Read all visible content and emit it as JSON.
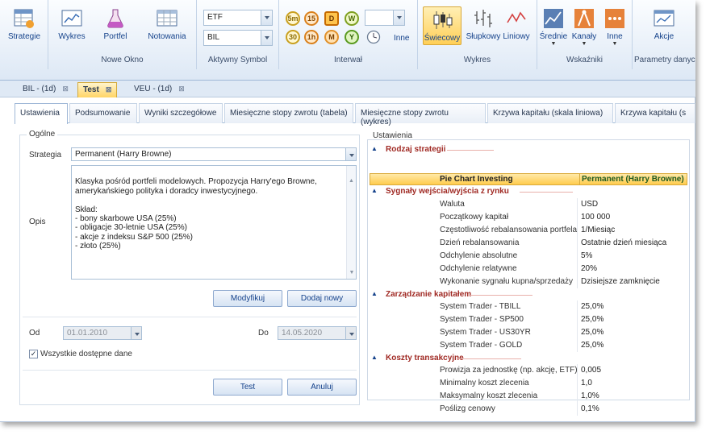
{
  "ribbon": {
    "strategie": "Strategie",
    "nowe_okno": {
      "label": "Nowe Okno",
      "items": [
        "Wykres",
        "Portfel",
        "Notowania"
      ]
    },
    "aktywny_symbol": {
      "label": "Aktywny Symbol",
      "symbol1": "ETF",
      "symbol2": "BIL"
    },
    "interwal": {
      "label": "Interwał",
      "row1": [
        "5m",
        "15",
        "D",
        "W"
      ],
      "row2": [
        "30",
        "1h",
        "M",
        "Y"
      ],
      "inne": "Inne"
    },
    "wykres": {
      "label": "Wykres",
      "items": [
        "Świecowy",
        "Słupkowy",
        "Liniowy"
      ]
    },
    "wskazniki": {
      "label": "Wskaźniki",
      "items": [
        "Średnie",
        "Kanały",
        "Inne"
      ]
    },
    "parametry": {
      "label": "Parametry danych",
      "akcje": "Akcje"
    }
  },
  "doc_tabs": [
    {
      "label": "BIL - (1d)",
      "active": false
    },
    {
      "label": "Test",
      "active": true
    },
    {
      "label": "VEU - (1d)",
      "active": false
    }
  ],
  "sub_tabs": [
    "Ustawienia",
    "Podsumowanie",
    "Wyniki szczegółowe",
    "Miesięczne stopy zwrotu (tabela)",
    "Miesięczne stopy zwrotu (wykres)",
    "Krzywa kapitału (skala liniowa)",
    "Krzywa kapitału (s"
  ],
  "ogolne": {
    "title": "Ogólne",
    "strategia_label": "Strategia",
    "strategia_value": "Permanent (Harry Browne)",
    "opis_label": "Opis",
    "opis_text": "Klasyka pośród portfeli modelowych. Propozycja Harry'ego Browne,\namerykańskiego polityka i doradcy inwestycyjnego.\n\nSkład:\n- bony skarbowe USA (25%)\n- obligacje 30-letnie USA (25%)\n- akcje z indeksu S&P 500 (25%)\n- złoto (25%)",
    "modyfikuj": "Modyfikuj",
    "dodaj_nowy": "Dodaj nowy",
    "od_label": "Od",
    "od_value": "01.01.2010",
    "do_label": "Do",
    "do_value": "14.05.2020",
    "wszystkie": "Wszystkie dostępne dane",
    "test": "Test",
    "anuluj": "Anuluj"
  },
  "ustawienia": {
    "title": "Ustawienia",
    "rodzaj": "Rodzaj strategii",
    "header_key": "Pie Chart Investing",
    "header_value": "Permanent (Harry Browne)",
    "sygnaly": "Sygnały wejścia/wyjścia z rynku",
    "sygnaly_rows": [
      {
        "k": "Waluta",
        "v": "USD"
      },
      {
        "k": "Początkowy kapitał",
        "v": "100 000"
      },
      {
        "k": "Częstotliwość rebalansowania portfela",
        "v": "1/Miesiąc"
      },
      {
        "k": "Dzień rebalansowania",
        "v": "Ostatnie dzień miesiąca"
      },
      {
        "k": "Odchylenie absolutne",
        "v": "5%"
      },
      {
        "k": "Odchylenie relatywne",
        "v": "20%"
      },
      {
        "k": "Wykonanie sygnału kupna/sprzedaży",
        "v": "Dzisiejsze zamknięcie"
      }
    ],
    "zarzadzanie": "Zarządzanie kapitałem",
    "zarzadzanie_rows": [
      {
        "k": "System Trader - TBILL",
        "v": "25,0%"
      },
      {
        "k": "System Trader - SP500",
        "v": "25,0%"
      },
      {
        "k": "System Trader - US30YR",
        "v": "25,0%"
      },
      {
        "k": "System Trader - GOLD",
        "v": "25,0%"
      }
    ],
    "koszty": "Koszty transakcyjne",
    "koszty_rows": [
      {
        "k": "Prowizja za jednostkę (np. akcję, ETF)",
        "v": "0,005"
      },
      {
        "k": "Minimalny koszt zlecenia",
        "v": "1,0"
      },
      {
        "k": "Maksymalny koszt zlecenia",
        "v": "1,0%"
      },
      {
        "k": "Poślizg cenowy",
        "v": "0,1%"
      }
    ]
  }
}
